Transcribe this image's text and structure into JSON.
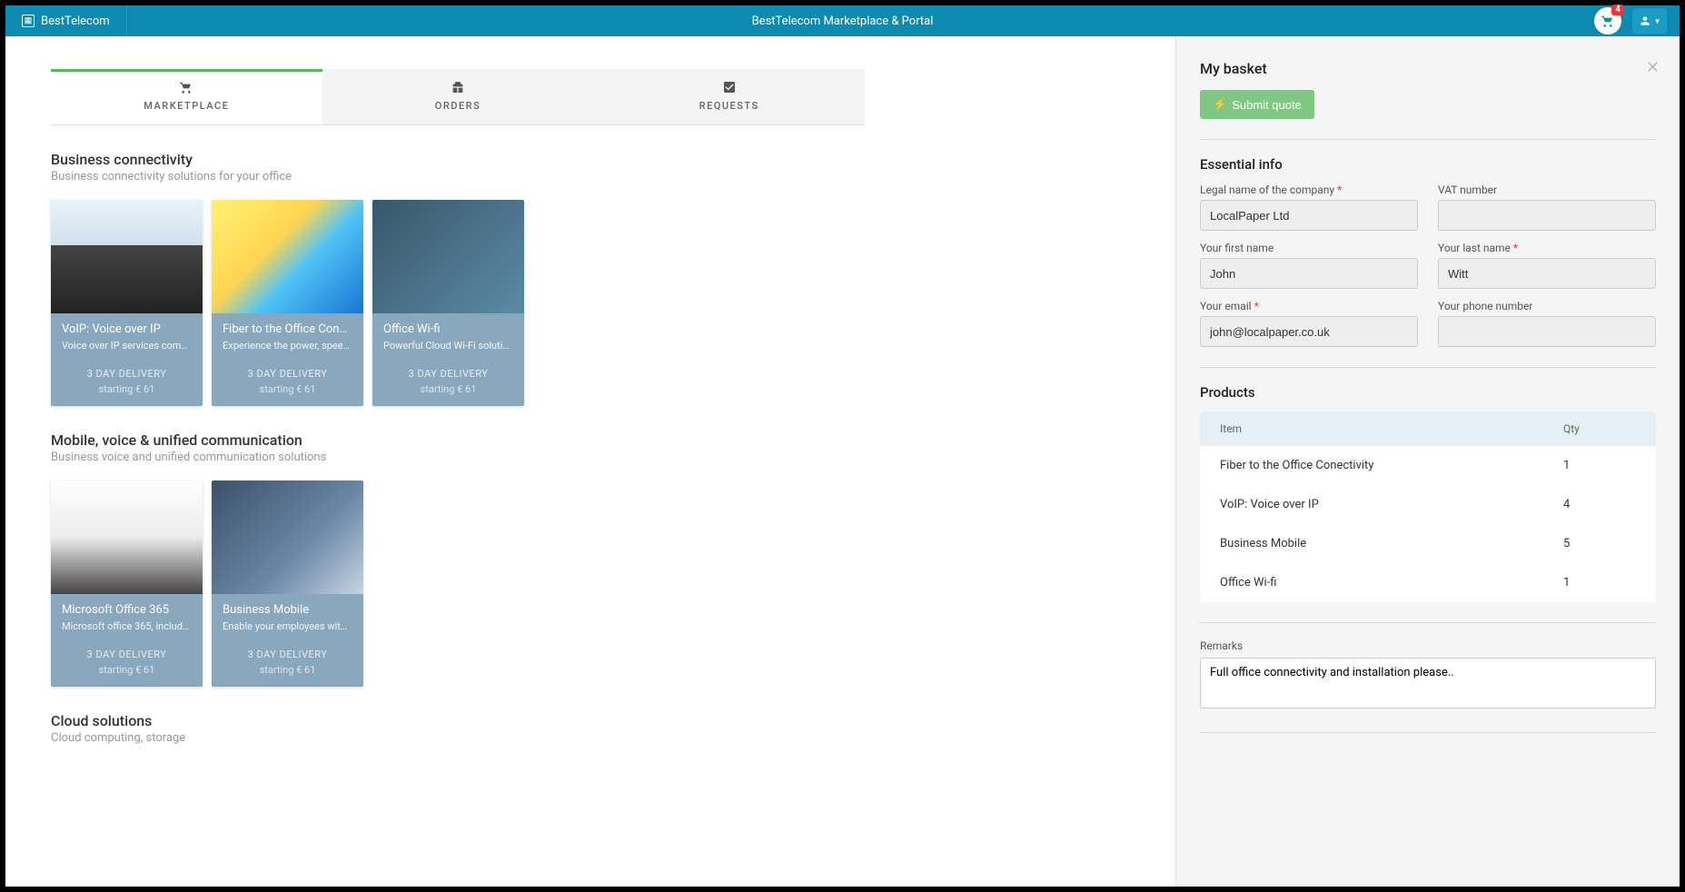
{
  "header": {
    "brand": "BestTelecom",
    "title": "BestTelecom Marketplace & Portal",
    "cart_count": "4"
  },
  "tabs": {
    "marketplace": "MARKETPLACE",
    "orders": "ORDERS",
    "requests": "REQUESTS"
  },
  "sections": [
    {
      "title": "Business connectivity",
      "subtitle": "Business connectivity solutions for your office",
      "cards": [
        {
          "title": "VoIP: Voice over IP",
          "desc": "Voice over IP services com…",
          "delivery": "3 DAY DELIVERY",
          "price": "starting € 61",
          "img": "img-voip"
        },
        {
          "title": "Fiber to the Office Cone…",
          "desc": "Experience the power, spee…",
          "delivery": "3 DAY DELIVERY",
          "price": "starting € 61",
          "img": "img-fiber"
        },
        {
          "title": "Office Wi-fi",
          "desc": "Powerful Cloud Wi-Fi soluti…",
          "delivery": "3 DAY DELIVERY",
          "price": "starting € 61",
          "img": "img-wifi"
        }
      ]
    },
    {
      "title": "Mobile, voice & unified communication",
      "subtitle": "Business voice and unified communication solutions",
      "cards": [
        {
          "title": "Microsoft Office 365",
          "desc": "Microsoft office 365, includ…",
          "delivery": "3 DAY DELIVERY",
          "price": "starting € 61",
          "img": "img-o365"
        },
        {
          "title": "Business Mobile",
          "desc": "Enable your employees wit…",
          "delivery": "3 DAY DELIVERY",
          "price": "starting € 61",
          "img": "img-mobile"
        }
      ]
    },
    {
      "title": "Cloud solutions",
      "subtitle": "Cloud computing, storage",
      "cards": []
    }
  ],
  "basket": {
    "title": "My basket",
    "submit_label": "Submit quote",
    "essential_title": "Essential info",
    "labels": {
      "legal_name": "Legal name of the company",
      "vat": "VAT number",
      "first_name": "Your first name",
      "last_name": "Your last name",
      "email": "Your email",
      "phone": "Your phone number"
    },
    "values": {
      "legal_name": "LocalPaper Ltd",
      "vat": "",
      "first_name": "John",
      "last_name": "Witt",
      "email": "john@localpaper.co.uk",
      "phone": ""
    },
    "products_title": "Products",
    "table_headers": {
      "item": "Item",
      "qty": "Qty"
    },
    "items": [
      {
        "name": "Fiber to the Office Conectivity",
        "qty": "1"
      },
      {
        "name": "VoIP: Voice over IP",
        "qty": "4"
      },
      {
        "name": "Business Mobile",
        "qty": "5"
      },
      {
        "name": "Office Wi-fi",
        "qty": "1"
      }
    ],
    "remarks_label": "Remarks",
    "remarks_value": "Full office connectivity and installation please.."
  }
}
